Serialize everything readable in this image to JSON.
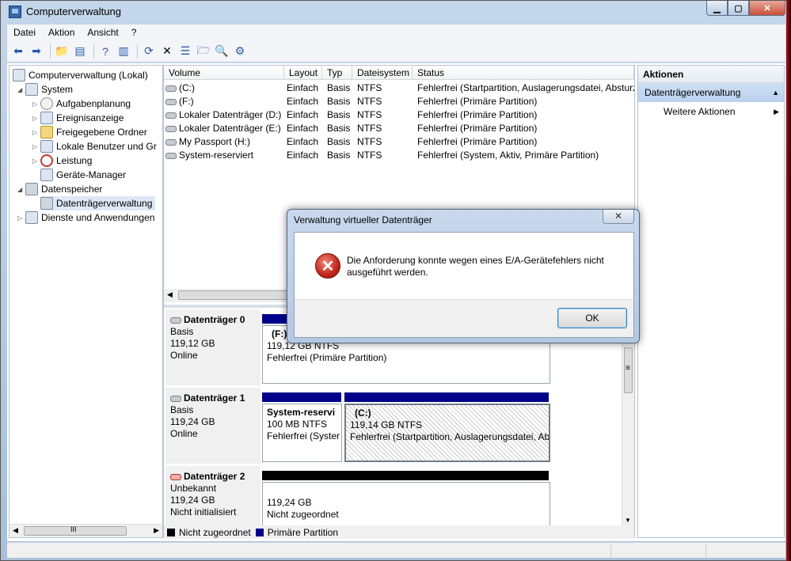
{
  "window": {
    "title": "Computerverwaltung"
  },
  "menu": [
    "Datei",
    "Aktion",
    "Ansicht",
    "?"
  ],
  "tree": {
    "root": "Computerverwaltung (Lokal)",
    "system": "System",
    "aufgaben": "Aufgabenplanung",
    "ereignis": "Ereignisanzeige",
    "freigabe": "Freigegebene Ordner",
    "benutzer": "Lokale Benutzer und Gr",
    "leistung": "Leistung",
    "geraete": "Geräte-Manager",
    "datenspeicher": "Datenspeicher",
    "dtv": "Datenträgerverwaltung",
    "dienste": "Dienste und Anwendungen"
  },
  "volumes": {
    "headers": [
      "Volume",
      "Layout",
      "Typ",
      "Dateisystem",
      "Status"
    ],
    "rows": [
      [
        "(C:)",
        "Einfach",
        "Basis",
        "NTFS",
        "Fehlerfrei (Startpartition, Auslagerungsdatei, Absturz"
      ],
      [
        "(F:)",
        "Einfach",
        "Basis",
        "NTFS",
        "Fehlerfrei (Primäre Partition)"
      ],
      [
        "Lokaler Datenträger (D:)",
        "Einfach",
        "Basis",
        "NTFS",
        "Fehlerfrei (Primäre Partition)"
      ],
      [
        "Lokaler Datenträger (E:)",
        "Einfach",
        "Basis",
        "NTFS",
        "Fehlerfrei (Primäre Partition)"
      ],
      [
        "My Passport (H:)",
        "Einfach",
        "Basis",
        "NTFS",
        "Fehlerfrei (Primäre Partition)"
      ],
      [
        "System-reserviert",
        "Einfach",
        "Basis",
        "NTFS",
        "Fehlerfrei (System, Aktiv, Primäre Partition)"
      ]
    ]
  },
  "disks": {
    "d0": {
      "name": "Datenträger 0",
      "type": "Basis",
      "size": "119,12 GB",
      "state": "Online",
      "p1": {
        "name": "(F:)",
        "size": "119,12 GB NTFS",
        "status": "Fehlerfrei (Primäre Partition)"
      }
    },
    "d1": {
      "name": "Datenträger 1",
      "type": "Basis",
      "size": "119,24 GB",
      "state": "Online",
      "p1": {
        "name": "System-reservi",
        "size": "100 MB NTFS",
        "status": "Fehlerfrei (Syster"
      },
      "p2": {
        "name": "(C:)",
        "size": "119,14 GB NTFS",
        "status": "Fehlerfrei (Startpartition, Auslagerungsdatei, Ab"
      }
    },
    "d2": {
      "name": "Datenträger 2",
      "type": "Unbekannt",
      "size": "119,24 GB",
      "state": "Nicht initialisiert",
      "p1": {
        "size": "119,24 GB",
        "status": "Nicht zugeordnet"
      }
    }
  },
  "legend": {
    "unalloc": "Nicht zugeordnet",
    "primary": "Primäre Partition",
    "unalloc_color": "#000000",
    "primary_color": "#00008b"
  },
  "actions": {
    "header": "Aktionen",
    "section": "Datenträgerverwaltung",
    "more": "Weitere Aktionen"
  },
  "dialog": {
    "title": "Verwaltung virtueller Datenträger",
    "message": "Die Anforderung konnte wegen eines E/A-Gerätefehlers nicht ausgeführt werden.",
    "ok": "OK",
    "close": "✕"
  },
  "icons": {
    "scroll_h": "III",
    "scroll_v": "≡"
  }
}
